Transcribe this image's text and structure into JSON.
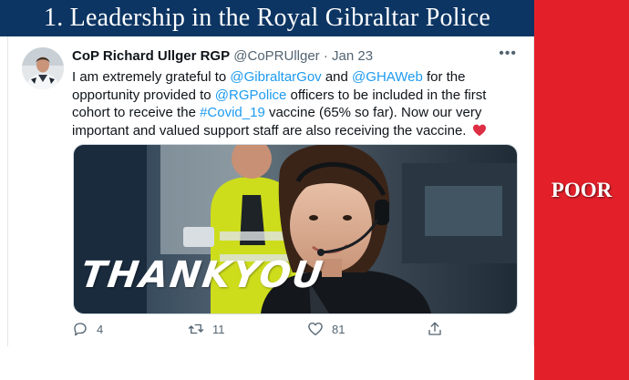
{
  "slide": {
    "title": "1. Leadership in the Royal Gibraltar Police",
    "rating": "POOR",
    "colors": {
      "header": "#0d3563",
      "rating_panel": "#e3202a",
      "link": "#1d9bf0"
    }
  },
  "tweet": {
    "author_name": "CoP Richard Ullger RGP",
    "handle": "@CoPRUllger",
    "separator": "·",
    "date": "Jan 23",
    "more_icon": "more-dots-icon",
    "body": {
      "text1": "I am extremely grateful to ",
      "mention1": "@GibraltarGov",
      "text2": " and ",
      "mention2": "@GHAWeb",
      "text3": " for the opportunity provided to ",
      "mention3": "@RGPolice",
      "text4": " officers to be included in the first cohort to receive the ",
      "hashtag": "#Covid_19",
      "text5": " vaccine (65% so far). Now our very important and valued support staff are also receiving the vaccine. ",
      "emoji": "red-heart-icon"
    },
    "media": {
      "overlay_text": "THANKYOU"
    },
    "actions": {
      "reply_count": "4",
      "retweet_count": "11",
      "like_count": "81",
      "icons": [
        "reply-icon",
        "retweet-icon",
        "like-icon",
        "share-icon"
      ]
    }
  }
}
